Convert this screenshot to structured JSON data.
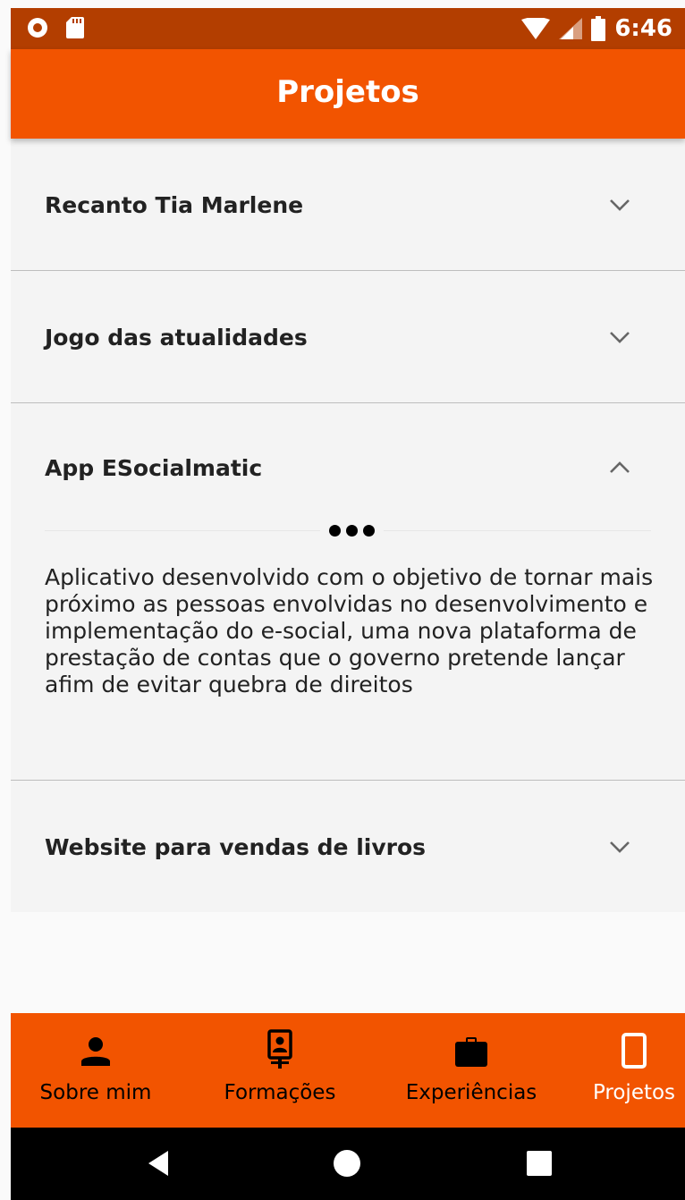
{
  "status_bar": {
    "time": "6:46",
    "icons": [
      "record-icon",
      "sd-card-icon",
      "wifi-icon",
      "signal-icon",
      "battery-icon"
    ]
  },
  "app_bar": {
    "title": "Projetos"
  },
  "projects": [
    {
      "title": "Recanto Tia Marlene",
      "expanded": false
    },
    {
      "title": "Jogo das atualidades",
      "expanded": false
    },
    {
      "title": "App ESocialmatic",
      "expanded": true,
      "description": "Aplicativo desenvolvido com o objetivo de tornar mais próximo as pessoas envolvidas no desenvolvimento e implementação do e-social, uma nova plataforma de prestação de contas que o governo pretende lançar afim de evitar quebra de direitos"
    },
    {
      "title": "Website para vendas de livros",
      "expanded": false
    }
  ],
  "bottom_nav": {
    "items": [
      {
        "label": "Sobre mim",
        "icon": "person-icon"
      },
      {
        "label": "Formações",
        "icon": "contact-card-icon"
      },
      {
        "label": "Experiências",
        "icon": "briefcase-icon"
      },
      {
        "label": "Projetos",
        "icon": "phone-icon",
        "active": true
      }
    ]
  },
  "colors": {
    "accent": "#f25400",
    "status_bar": "#b33e00",
    "active_label": "#ffffff"
  }
}
